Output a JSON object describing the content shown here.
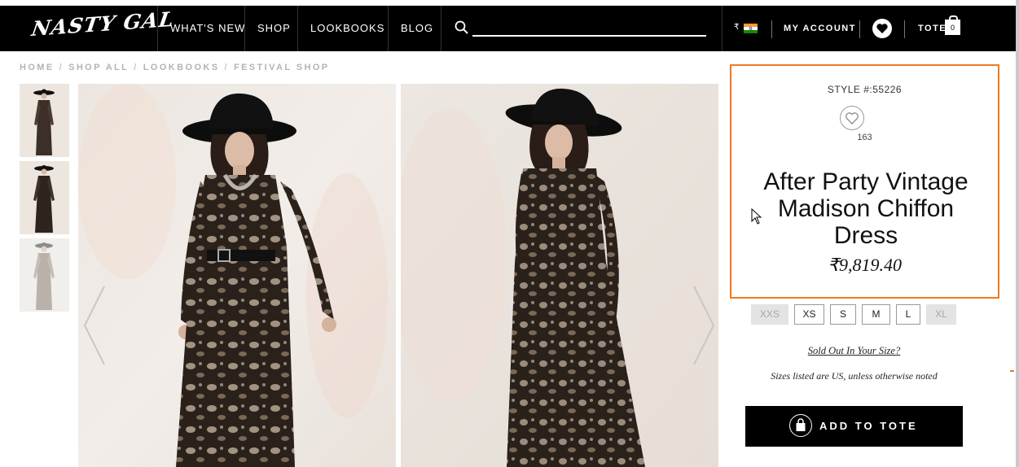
{
  "header": {
    "logo_text": "NASTY GAL",
    "nav": [
      "WHAT'S NEW",
      "SHOP",
      "LOOKBOOKS",
      "BLOG"
    ],
    "search_placeholder": "",
    "currency_symbol": "₹",
    "country": "India",
    "account_label": "MY ACCOUNT",
    "tote_label": "TOTE",
    "tote_count": "0"
  },
  "breadcrumb": [
    "HOME",
    "SHOP ALL",
    "LOOKBOOKS",
    "FESTIVAL SHOP"
  ],
  "product": {
    "style_number": "STYLE #:55226",
    "favorites_count": "163",
    "title": "After Party Vintage Madison Chiffon Dress",
    "price": "₹9,819.40",
    "sizes": [
      {
        "label": "XXS",
        "available": false
      },
      {
        "label": "XS",
        "available": true
      },
      {
        "label": "S",
        "available": true
      },
      {
        "label": "M",
        "available": true
      },
      {
        "label": "L",
        "available": true
      },
      {
        "label": "XL",
        "available": false
      }
    ],
    "sold_out_link": "Sold Out In Your Size?",
    "sizes_note": "Sizes listed are US, unless otherwise noted",
    "add_to_tote": "ADD TO TOTE"
  },
  "colors": {
    "accent_highlight": "#f07a1f",
    "nav_background": "#000000",
    "dress_dark": "#2b211b",
    "dress_light": "#c9b8a4"
  }
}
